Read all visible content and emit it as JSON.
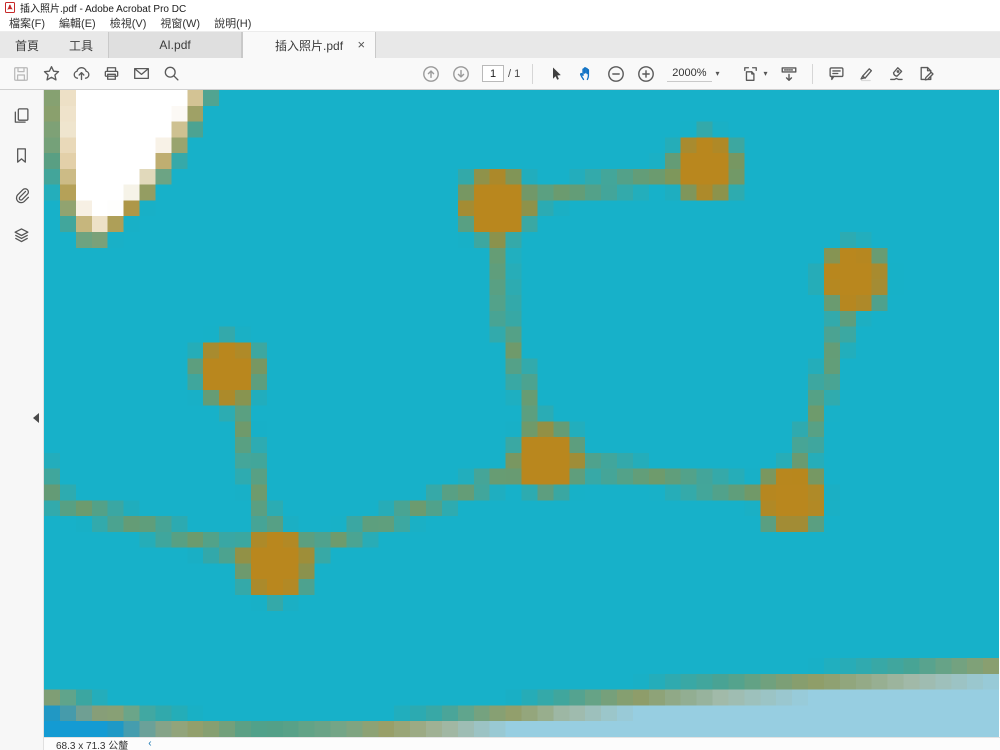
{
  "window": {
    "title": "插入照片.pdf - Adobe Acrobat Pro DC"
  },
  "menu": {
    "items": [
      "檔案(F)",
      "編輯(E)",
      "檢視(V)",
      "視窗(W)",
      "說明(H)"
    ]
  },
  "tabs": {
    "home": "首頁",
    "tools": "工具",
    "docs": [
      {
        "label": "AI.pdf",
        "active": false
      },
      {
        "label": "插入照片.pdf",
        "active": true
      }
    ],
    "close_glyph": "×"
  },
  "toolbar": {
    "page_current": "1",
    "page_total": "/ 1",
    "zoom_level": "2000%",
    "caret": "▾",
    "icon_names_left": [
      "save-icon",
      "star-icon",
      "share-upload-icon",
      "print-icon",
      "email-icon",
      "search-icon"
    ],
    "icon_names_center": [
      "page-up-icon",
      "page-down-icon",
      "pointer-icon",
      "hand-tool-icon",
      "zoom-out-icon",
      "zoom-in-icon"
    ],
    "icon_names_right": [
      "page-fit-icon",
      "hide-toolbar-icon",
      "comment-icon",
      "highlight-icon",
      "fill-sign-icon",
      "edit-pdf-icon"
    ],
    "active_tool": "hand-tool"
  },
  "sidebar": {
    "icon_names": [
      "page-thumbnails-icon",
      "bookmarks-icon",
      "attachments-icon",
      "layers-icon"
    ]
  },
  "statusbar": {
    "dimensions": "68.3 x 71.3 公釐",
    "chevron": "‹"
  },
  "artwork": {
    "description": "pixelated constellation artwork at 2000% zoom",
    "grid": {
      "cols": 60,
      "rows": 41
    },
    "colors": {
      "teal": "#17b1c9",
      "gold": "#b9871e",
      "white": "#ffffff",
      "pale_blue": "#97cee1",
      "azure": "#149bd3"
    },
    "line_width": 0.55,
    "nodes": [
      [
        28.4,
        7.3,
        2.2
      ],
      [
        41.6,
        4.9,
        2.15
      ],
      [
        50.9,
        12.0,
        2.15
      ],
      [
        11.6,
        17.8,
        2.1
      ],
      [
        31.6,
        23.4,
        2.15
      ],
      [
        14.6,
        30.0,
        2.3
      ],
      [
        47.0,
        25.9,
        2.15
      ]
    ],
    "edges": [
      [
        0,
        1
      ],
      [
        2,
        6
      ],
      [
        4,
        6
      ],
      [
        3,
        5
      ],
      [
        4,
        5
      ]
    ],
    "polylines": [
      [
        [
          28.4,
          7.3
        ],
        [
          28.9,
          14.5
        ],
        [
          31.6,
          23.4
        ]
      ],
      [
        [
          -0.3,
          23.4
        ],
        [
          0.3,
          25.9
        ],
        [
          14.6,
          30.0
        ]
      ]
    ],
    "moon": {
      "path": [
        [
          "M",
          0.85,
          -0.6
        ],
        [
          "C",
          0.55,
          3.2,
          1.05,
          7.2,
          2.6,
          9.35
        ],
        [
          "C",
          4.3,
          9.6,
          7.6,
          5.8,
          10.45,
          -0.6
        ],
        [
          "Z"
        ]
      ],
      "stroke_width": 0.8
    },
    "shore": {
      "curve": [
        [
          "M",
          -0.5,
          38.4
        ],
        [
          "Q",
          7,
          40.6,
          13,
          40.9
        ],
        [
          "Q",
          19,
          41.1,
          25,
          40.1
        ],
        [
          "Q",
          33,
          38.9,
          40,
          38.2
        ],
        [
          "L",
          60.5,
          36.5
        ]
      ],
      "pale_close": [
        [
          "L",
          60.5,
          41.5
        ],
        [
          "L",
          -0.5,
          41.5
        ],
        [
          "Z"
        ]
      ],
      "azure_fill": [
        [
          "M",
          -0.5,
          38.6
        ],
        [
          "Q",
          5,
          40.4,
          9,
          40.9
        ],
        [
          "L",
          13.5,
          41.5
        ],
        [
          "L",
          -0.5,
          41.5
        ],
        [
          "Z"
        ]
      ],
      "stroke_width": 0.6
    }
  }
}
